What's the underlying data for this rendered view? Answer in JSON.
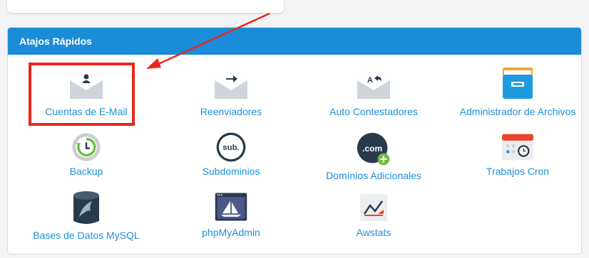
{
  "panel": {
    "title": "Atajos Rápidos"
  },
  "shortcuts": [
    {
      "label": "Cuentas de E-Mail",
      "icon": "email-account-icon"
    },
    {
      "label": "Reenviadores",
      "icon": "forwarder-icon"
    },
    {
      "label": "Auto Contestadores",
      "icon": "autoresponder-icon"
    },
    {
      "label": "Administrador de Archivos",
      "icon": "file-manager-icon"
    },
    {
      "label": "Backup",
      "icon": "backup-icon"
    },
    {
      "label": "Subdominios",
      "icon": "subdomains-icon"
    },
    {
      "label": "Domínios Adicionales",
      "icon": "addon-domains-icon"
    },
    {
      "label": "Trabajos Cron",
      "icon": "cron-jobs-icon"
    },
    {
      "label": "Bases de Datos MySQL",
      "icon": "mysql-database-icon"
    },
    {
      "label": "phpMyAdmin",
      "icon": "phpmyadmin-icon"
    },
    {
      "label": "Awstats",
      "icon": "awstats-icon"
    }
  ],
  "colors": {
    "header": "#1b8cd8",
    "link": "#1d8fd8",
    "highlight": "#e8271b"
  }
}
